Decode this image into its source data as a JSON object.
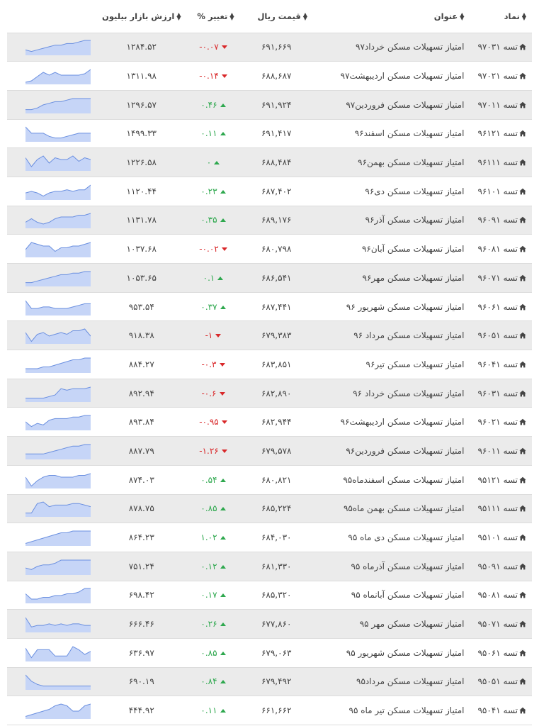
{
  "colors": {
    "up": "#2ea84e",
    "down": "#d9292b",
    "spark_fill": "#c6d5f7",
    "spark_line": "#6a8fe0",
    "row_alt": "#ebebeb"
  },
  "icons": {
    "sort": "sort-icon",
    "home": "home-icon",
    "up": "triangle-up-icon",
    "down": "triangle-down-icon"
  },
  "headers": {
    "symbol": "نماد",
    "title": "عنوان",
    "price": "قیمت ریال",
    "change": "تغییر %",
    "cap": "ارزش بازار بیلیون"
  },
  "rows": [
    {
      "symbol": "تسه ۹۷۰۳۱",
      "title": "امتیاز تسهیلات مسکن خرداد۹۷",
      "price": "۶۹۱,۶۶۹",
      "change": "-۰.۰۷",
      "dir": "down",
      "cap": "۱۲۸۴.۵۲",
      "spark": [
        3,
        2,
        3,
        4,
        5,
        6,
        6,
        7,
        7,
        8,
        9,
        9
      ]
    },
    {
      "symbol": "تسه ۹۷۰۲۱",
      "title": "امتیاز تسهیلات مسکن اردیبهشت۹۷",
      "price": "۶۸۸,۶۸۷",
      "change": "-۰.۱۴",
      "dir": "down",
      "cap": "۱۳۱۱.۹۸",
      "spark": [
        1,
        2,
        5,
        8,
        6,
        8,
        6,
        6,
        6,
        6,
        7,
        10
      ]
    },
    {
      "symbol": "تسه ۹۷۰۱۱",
      "title": "امتیاز تسهیلات مسکن فروردین۹۷",
      "price": "۶۹۱,۹۲۴",
      "change": "۰.۴۶",
      "dir": "up",
      "cap": "۱۲۹۶.۵۷",
      "spark": [
        2,
        2,
        3,
        5,
        6,
        7,
        7,
        8,
        9,
        9,
        9,
        9
      ]
    },
    {
      "symbol": "تسه ۹۶۱۲۱",
      "title": "امتیاز تسهیلات مسکن اسفند۹۶",
      "price": "۶۹۱,۴۱۷",
      "change": "۰.۱۱",
      "dir": "up",
      "cap": "۱۴۹۹.۳۳",
      "spark": [
        9,
        5,
        5,
        5,
        3,
        2,
        2,
        3,
        4,
        5,
        5,
        5
      ]
    },
    {
      "symbol": "تسه ۹۶۱۱۱",
      "title": "امتیاز تسهیلات مسکن بهمن۹۶",
      "price": "۶۸۸,۴۸۴",
      "change": "۰",
      "dir": "up",
      "cap": "۱۲۲۶.۵۸",
      "spark": [
        7,
        2,
        6,
        8,
        4,
        7,
        6,
        6,
        8,
        5,
        7,
        6
      ]
    },
    {
      "symbol": "تسه ۹۶۱۰۱",
      "title": "امتیاز تسهیلات مسکن دی۹۶",
      "price": "۶۸۷,۴۰۲",
      "change": "۰.۲۳",
      "dir": "up",
      "cap": "۱۱۲۰.۴۴",
      "spark": [
        4,
        5,
        4,
        2,
        4,
        5,
        5,
        6,
        5,
        6,
        6,
        9
      ]
    },
    {
      "symbol": "تسه ۹۶۰۹۱",
      "title": "امتیاز تسهیلات مسکن آذر۹۶",
      "price": "۶۸۹,۱۷۶",
      "change": "۰.۳۵",
      "dir": "up",
      "cap": "۱۱۳۱.۷۸",
      "spark": [
        3,
        5,
        3,
        2,
        3,
        5,
        6,
        6,
        6,
        7,
        7,
        8
      ]
    },
    {
      "symbol": "تسه ۹۶۰۸۱",
      "title": "امتیاز تسهیلات مسکن آبان۹۶",
      "price": "۶۸۰,۷۹۸",
      "change": "-۰.۰۲",
      "dir": "down",
      "cap": "۱۰۳۷.۶۸",
      "spark": [
        4,
        8,
        7,
        6,
        6,
        3,
        5,
        5,
        6,
        6,
        7,
        8
      ]
    },
    {
      "symbol": "تسه ۹۶۰۷۱",
      "title": "امتیاز تسهیلات مسکن مهر۹۶",
      "price": "۶۸۶,۵۴۱",
      "change": "۰.۱",
      "dir": "up",
      "cap": "۱۰۵۳.۶۵",
      "spark": [
        2,
        2,
        3,
        4,
        5,
        6,
        7,
        7,
        8,
        8,
        9,
        9
      ]
    },
    {
      "symbol": "تسه ۹۶۰۶۱",
      "title": "امتیاز تسهیلات مسکن شهریور ۹۶",
      "price": "۶۸۷,۴۴۱",
      "change": "۰.۳۷",
      "dir": "up",
      "cap": "۹۵۳.۵۴",
      "spark": [
        9,
        4,
        4,
        5,
        5,
        4,
        4,
        4,
        5,
        6,
        7,
        7
      ]
    },
    {
      "symbol": "تسه ۹۶۰۵۱",
      "title": "امتیاز تسهیلات مسکن مرداد ۹۶",
      "price": "۶۷۹,۳۸۳",
      "change": "-۱",
      "dir": "down",
      "cap": "۹۱۸.۳۸",
      "spark": [
        6,
        1,
        5,
        6,
        4,
        5,
        6,
        5,
        7,
        7,
        8,
        4
      ]
    },
    {
      "symbol": "تسه ۹۶۰۴۱",
      "title": "امتیاز تسهیلات مسکن تیر۹۶",
      "price": "۶۸۳,۸۵۱",
      "change": "-۰.۳",
      "dir": "down",
      "cap": "۸۸۴.۲۷",
      "spark": [
        2,
        2,
        2,
        3,
        3,
        4,
        5,
        6,
        7,
        7,
        8,
        8
      ]
    },
    {
      "symbol": "تسه ۹۶۰۳۱",
      "title": "امتیاز تسهیلات مسکن خرداد ۹۶",
      "price": "۶۸۲,۸۹۰",
      "change": "-۰.۶",
      "dir": "down",
      "cap": "۸۹۲.۹۴",
      "spark": [
        2,
        2,
        2,
        2,
        3,
        4,
        8,
        7,
        8,
        8,
        8,
        9
      ]
    },
    {
      "symbol": "تسه ۹۶۰۲۱",
      "title": "امتیاز تسهیلات مسکن اردیبهشت۹۶",
      "price": "۶۸۲,۹۴۴",
      "change": "-۰.۹۵",
      "dir": "down",
      "cap": "۸۹۳.۸۴",
      "spark": [
        5,
        2,
        4,
        3,
        6,
        7,
        7,
        7,
        8,
        8,
        9,
        9
      ]
    },
    {
      "symbol": "تسه ۹۶۰۱۱",
      "title": "امتیاز تسهیلات مسکن فروردین۹۶",
      "price": "۶۷۹,۵۷۸",
      "change": "-۱.۲۶",
      "dir": "down",
      "cap": "۸۸۷.۷۹",
      "spark": [
        3,
        3,
        3,
        3,
        4,
        5,
        6,
        7,
        8,
        8,
        9,
        9
      ]
    },
    {
      "symbol": "تسه ۹۵۱۲۱",
      "title": "امتیاز تسهیلات مسکن اسفندماه۹۵",
      "price": "۶۸۰,۸۲۱",
      "change": "۰.۵۴",
      "dir": "up",
      "cap": "۸۷۴.۰۳",
      "spark": [
        6,
        1,
        4,
        6,
        7,
        7,
        6,
        6,
        6,
        7,
        7,
        8
      ]
    },
    {
      "symbol": "تسه ۹۵۱۱۱",
      "title": "امتیاز تسهیلات مسکن بهمن ماه۹۵",
      "price": "۶۸۵,۲۲۴",
      "change": "۰.۸۵",
      "dir": "up",
      "cap": "۸۷۸.۷۵",
      "spark": [
        2,
        2,
        8,
        9,
        6,
        7,
        7,
        7,
        8,
        8,
        7,
        6
      ]
    },
    {
      "symbol": "تسه ۹۵۱۰۱",
      "title": "امتیاز تسهیلات مسکن دی ماه ۹۵",
      "price": "۶۸۴,۰۳۰",
      "change": "۱.۰۲",
      "dir": "up",
      "cap": "۸۶۴.۲۳",
      "spark": [
        1,
        2,
        3,
        4,
        5,
        6,
        7,
        7,
        8,
        8,
        8,
        8
      ]
    },
    {
      "symbol": "تسه ۹۵۰۹۱",
      "title": "امتیاز تسهیلات مسکن آذرماه ۹۵",
      "price": "۶۸۱,۳۳۰",
      "change": "۰.۱۲",
      "dir": "up",
      "cap": "۷۵۱.۲۴",
      "spark": [
        4,
        3,
        5,
        6,
        6,
        7,
        9,
        9,
        9,
        9,
        9,
        9
      ]
    },
    {
      "symbol": "تسه ۹۵۰۸۱",
      "title": "امتیاز تسهیلات مسکن آبانماه ۹۵",
      "price": "۶۸۵,۳۲۰",
      "change": "۰.۱۷",
      "dir": "up",
      "cap": "۶۹۸.۴۲",
      "spark": [
        5,
        2,
        2,
        3,
        3,
        4,
        4,
        5,
        5,
        6,
        8,
        8
      ]
    },
    {
      "symbol": "تسه ۹۵۰۷۱",
      "title": "امتیاز تسهیلات مسکن مهر ۹۵",
      "price": "۶۷۷,۸۶۰",
      "change": "۰.۲۶",
      "dir": "up",
      "cap": "۶۶۶.۴۶",
      "spark": [
        9,
        3,
        4,
        4,
        5,
        4,
        5,
        4,
        5,
        5,
        4,
        4
      ]
    },
    {
      "symbol": "تسه ۹۵۰۶۱",
      "title": "امتیاز تسهیلات مسکن شهریور ۹۵",
      "price": "۶۷۹,۰۶۳",
      "change": "۰.۸۵",
      "dir": "up",
      "cap": "۶۳۶.۹۷",
      "spark": [
        8,
        2,
        7,
        7,
        7,
        3,
        3,
        3,
        9,
        7,
        4,
        6
      ]
    },
    {
      "symbol": "تسه ۹۵۰۵۱",
      "title": "امتیاز تسهیلات مسکن مرداد۹۵",
      "price": "۶۷۹,۴۹۲",
      "change": "۰.۸۴",
      "dir": "up",
      "cap": "۶۹۰.۱۹",
      "spark": [
        9,
        5,
        3,
        2,
        2,
        2,
        2,
        2,
        2,
        2,
        2,
        2
      ]
    },
    {
      "symbol": "تسه ۹۵۰۴۱",
      "title": "امتیاز تسهیلات مسکن تیر ماه ۹۵",
      "price": "۶۶۱,۶۶۲",
      "change": "۰.۱۱",
      "dir": "up",
      "cap": "۴۴۴.۹۲",
      "spark": [
        1,
        2,
        3,
        4,
        5,
        7,
        8,
        7,
        4,
        4,
        7,
        8
      ]
    }
  ]
}
